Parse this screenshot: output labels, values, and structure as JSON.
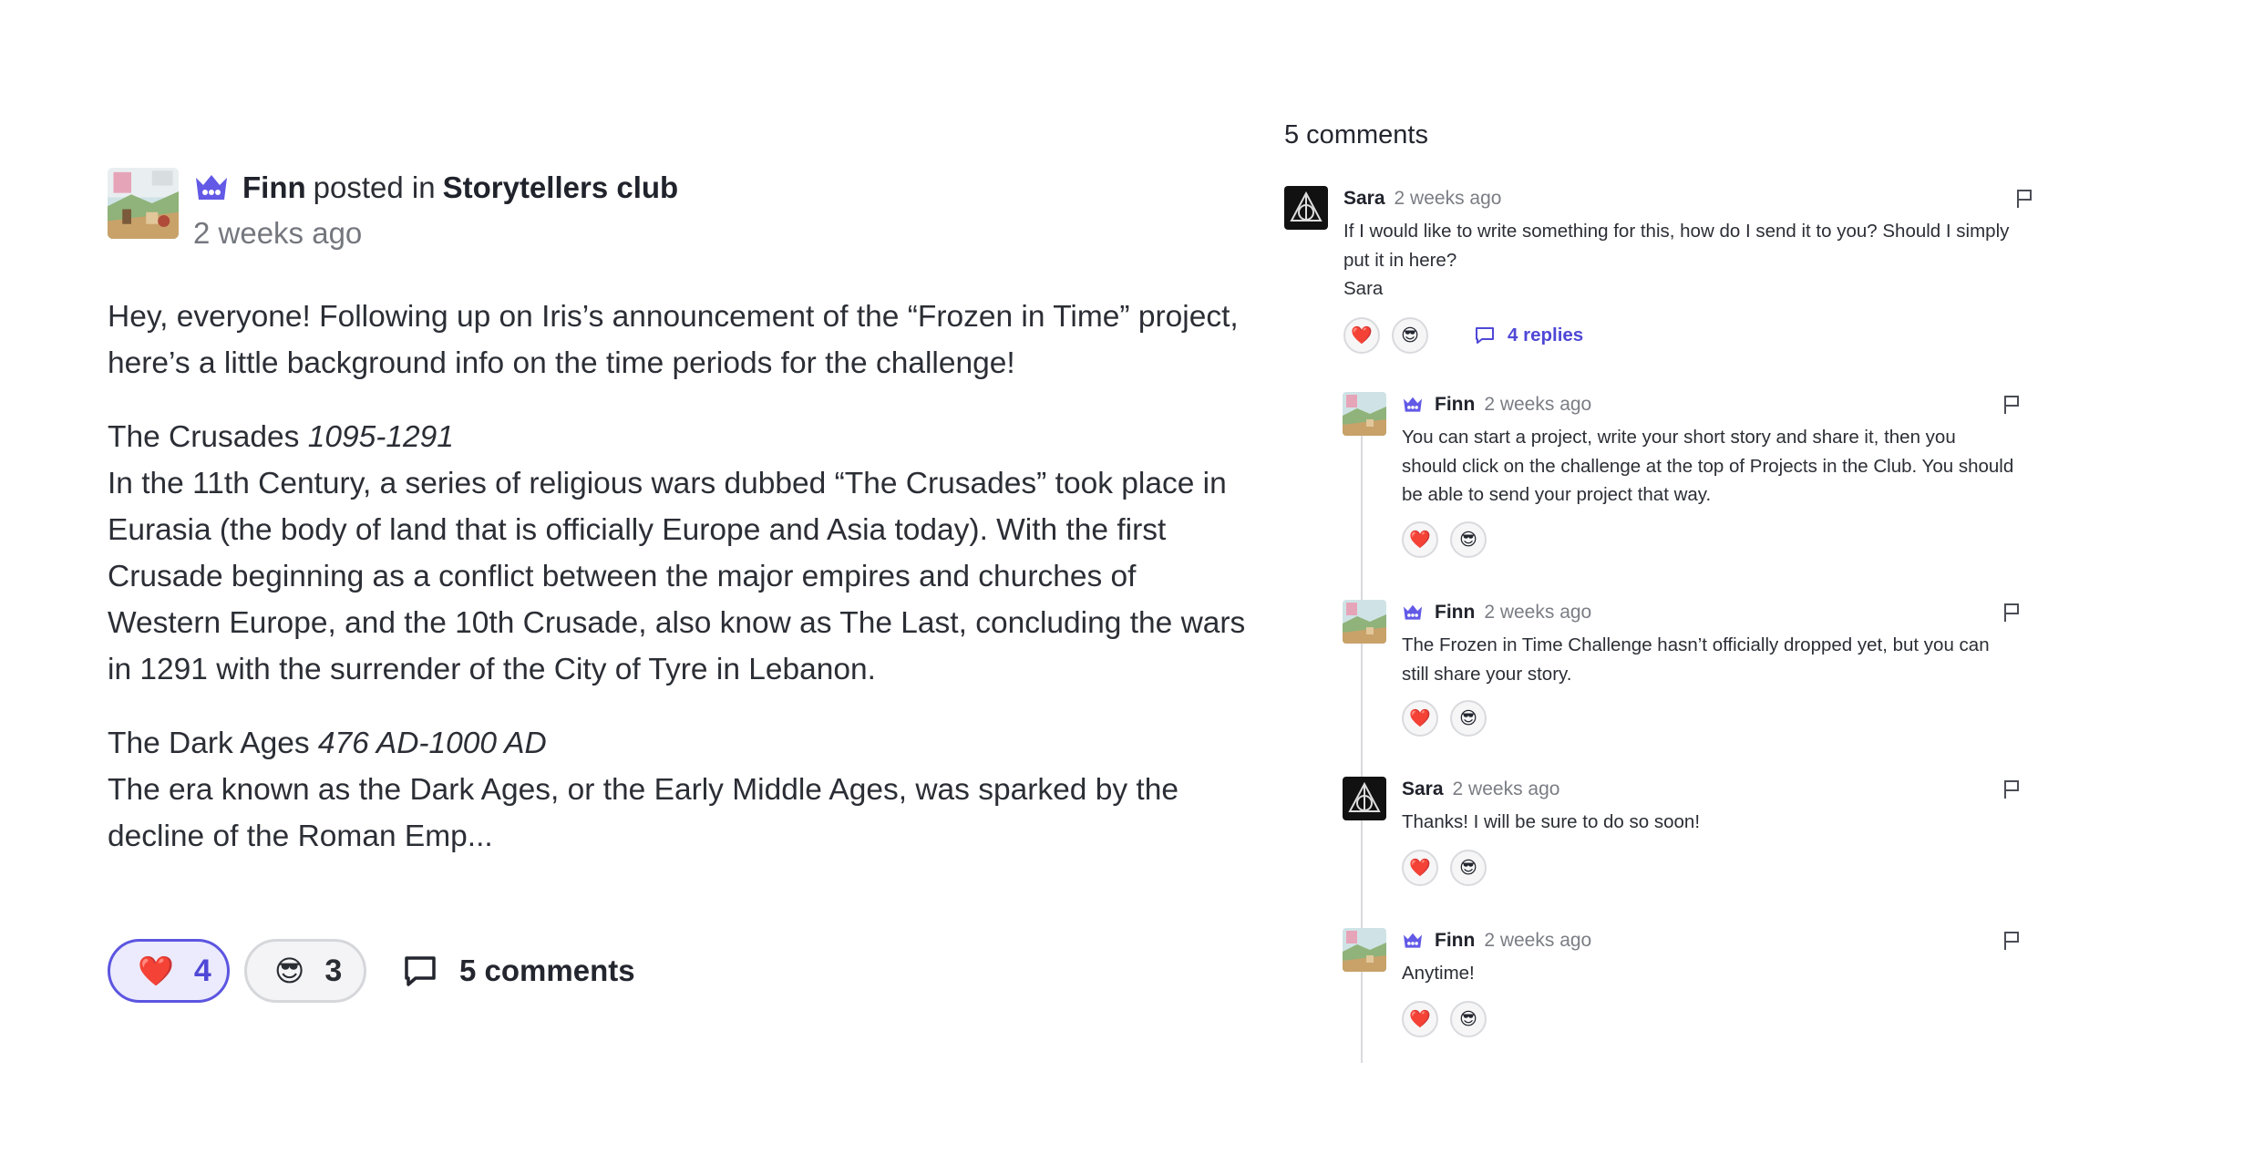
{
  "post": {
    "author": "Finn",
    "posted_in": "posted in",
    "club": "Storytellers club",
    "time": "2 weeks ago",
    "intro": "Hey, everyone! Following up on Iris’s announcement of the “Frozen in Time” project, here’s a little background info on the time periods for the challenge!",
    "section1_title": "The Crusades",
    "section1_dates": "1095-1291",
    "section1_body": "In the 11th Century, a series of religious wars dubbed “The Crusades” took place in Eurasia (the body of land that is officially Europe and Asia today). With the first Crusade beginning as a conflict between the major empires and churches of Western Europe, and the 10th Crusade, also know as The Last, concluding the wars in 1291 with the surrender of the City of Tyre in Lebanon.",
    "section2_title": "The Dark Ages",
    "section2_dates": "476 AD-1000 AD",
    "section2_body": "The era known as the Dark Ages, or the Early Middle Ages, was sparked by the decline of the Roman Emp...",
    "reactions": [
      {
        "emoji": "❤️",
        "count": "4",
        "active": true
      },
      {
        "emoji": "😎",
        "count": "3",
        "active": false
      }
    ],
    "comments_label": "5 comments"
  },
  "comments": {
    "title": "5 comments",
    "items": [
      {
        "author": "Sara",
        "time": "2 weeks ago",
        "text_lines": [
          "If I would like to write something for this, how do I send it to you? Should I simply",
          "put it in here?",
          "Sara"
        ],
        "replies_label": "4 replies"
      },
      {
        "author": "Finn",
        "time": "2 weeks ago",
        "text_lines": [
          "You can start a project, write your short story and share it, then you",
          "should click on the challenge at the top of Projects in the Club. You should",
          "be able to send your project that way."
        ]
      },
      {
        "author": "Finn",
        "time": "2 weeks ago",
        "text_lines": [
          "The Frozen in Time Challenge hasn’t officially dropped yet, but you can",
          "still share your story."
        ]
      },
      {
        "author": "Sara",
        "time": "2 weeks ago",
        "text_lines": [
          "Thanks! I will be sure to do so soon!"
        ]
      },
      {
        "author": "Finn",
        "time": "2 weeks ago",
        "text_lines": [
          "Anytime!"
        ]
      }
    ],
    "reaction_emojis": [
      "❤️",
      "😎"
    ]
  },
  "colors": {
    "accent": "#5c55e0",
    "accent_bg": "#ecebfd",
    "text": "#23262e",
    "muted": "#74777e"
  },
  "icons": {
    "crown": "crown-icon",
    "comment": "comment-bubble-icon",
    "flag": "flag-icon",
    "avatar_finn": "landscape-avatar",
    "avatar_sara": "deathly-hallows-avatar"
  }
}
